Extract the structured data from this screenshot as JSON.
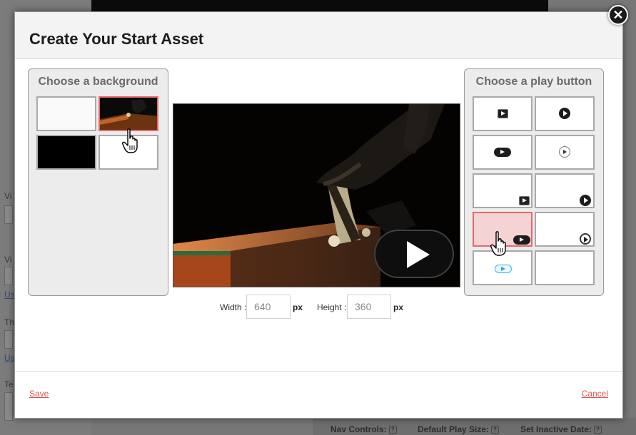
{
  "background_page": {
    "left_labels": [
      "Vi",
      "Vi",
      "Th",
      "Te"
    ],
    "left_links": [
      "Us",
      "Us"
    ],
    "bottom_labels": [
      "Nav Controls:",
      "Default Play Size:",
      "Set Inactive Date:"
    ],
    "help_glyph": "?"
  },
  "modal": {
    "title": "Create Your Start Asset",
    "close_glyph": "✕",
    "background_panel": {
      "title": "Choose a background",
      "options": [
        "white",
        "video-frame",
        "black",
        "white"
      ],
      "selected_index": 1
    },
    "play_button_panel": {
      "title": "Choose a play button",
      "options": [
        "square-play-icon",
        "circle-play-icon",
        "pill-play-icon",
        "ring-play-icon",
        "corner-square-play-icon",
        "corner-circle-play-icon",
        "corner-pill-play-icon",
        "corner-ring-play-icon",
        "blue-pill-play-icon",
        "no-play-icon"
      ],
      "selected_index": 6
    },
    "dimensions": {
      "width_label": "Width :",
      "width_value": "640",
      "height_label": "Height :",
      "height_value": "360",
      "unit": "px"
    },
    "footer": {
      "save_label": "Save",
      "cancel_label": "Cancel"
    }
  },
  "colors": {
    "accent_red": "#d9534f",
    "selected_border": "#e36a6a",
    "selected_fill": "#f5d3d4",
    "blue_icon": "#2aa3dd"
  }
}
